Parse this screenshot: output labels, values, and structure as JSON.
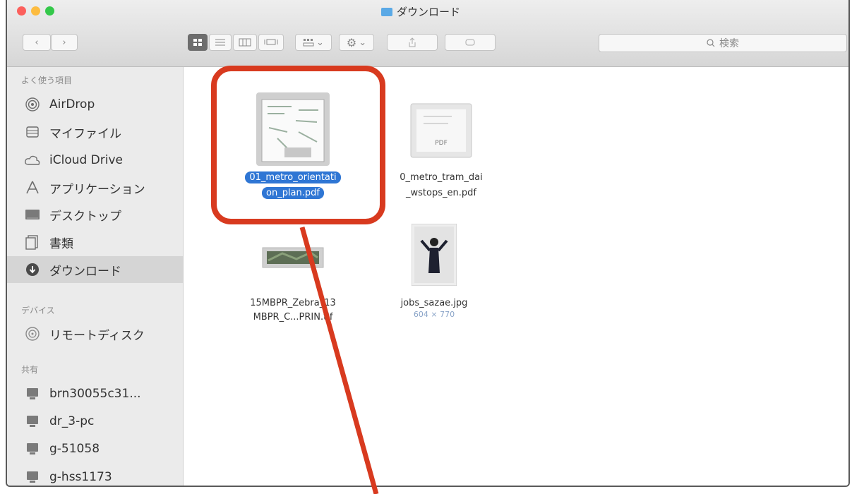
{
  "window": {
    "title": "ダウンロード",
    "traffic_lights": [
      "#fc605c",
      "#fdbc40",
      "#34c84a"
    ]
  },
  "toolbar": {
    "back_icon": "chevron-left-icon",
    "forward_icon": "chevron-right-icon",
    "views": [
      "icon-view-icon",
      "list-view-icon",
      "column-view-icon",
      "gallery-view-icon"
    ],
    "search_placeholder": "検索"
  },
  "sidebar": {
    "favorites_header": "よく使う項目",
    "favorites": [
      {
        "label": "AirDrop",
        "icon": "airdrop-icon"
      },
      {
        "label": "マイファイル",
        "icon": "all-files-icon"
      },
      {
        "label": "iCloud Drive",
        "icon": "cloud-icon"
      },
      {
        "label": "アプリケーション",
        "icon": "applications-icon"
      },
      {
        "label": "デスクトップ",
        "icon": "desktop-icon"
      },
      {
        "label": "書類",
        "icon": "documents-icon"
      },
      {
        "label": "ダウンロード",
        "icon": "downloads-icon",
        "active": true
      }
    ],
    "devices_header": "デバイス",
    "devices": [
      {
        "label": "リモートディスク",
        "icon": "remote-disc-icon"
      }
    ],
    "shared_header": "共有",
    "shared": [
      {
        "label": "brn30055c31...",
        "icon": "computer-icon"
      },
      {
        "label": "dr_3-pc",
        "icon": "computer-icon"
      },
      {
        "label": "g-51058",
        "icon": "computer-icon"
      },
      {
        "label": "g-hss1173",
        "icon": "computer-icon"
      }
    ]
  },
  "files": [
    {
      "name_line1": "01_metro_orientati",
      "name_line2": "on_plan.pdf",
      "selected": true,
      "icon": "pdf-thumbnail-icon"
    },
    {
      "name_line1": "0_metro_tram_dai",
      "name_line2": "_wstops_en.pdf",
      "selected": false,
      "icon": "pdf-file-icon",
      "badge": "PDF"
    },
    {
      "name_line1": "15MBPR_Zebra_13",
      "name_line2": "MBPR_C...PRIN.tif",
      "selected": false,
      "icon": "tif-thumbnail-icon"
    },
    {
      "name_line1": "jobs_sazae.jpg",
      "sub": "604 × 770",
      "selected": false,
      "icon": "jpg-thumbnail-icon"
    }
  ],
  "annotation": {
    "color": "#d83a1f"
  }
}
